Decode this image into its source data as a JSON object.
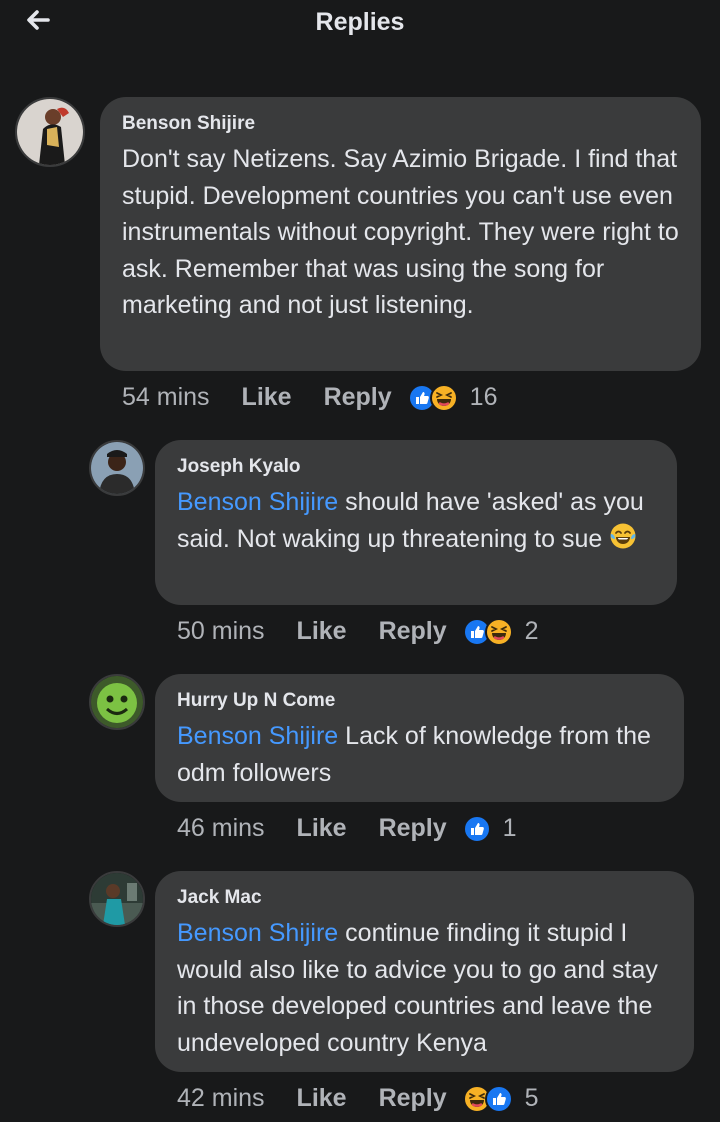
{
  "header": {
    "title": "Replies"
  },
  "comments": [
    {
      "author": "Benson Shijire",
      "text": "Don't say Netizens. Say Azimio Brigade. I find that stupid. Development countries you can't use even instrumentals without copyright. They were right to ask. Remember that was using the song for marketing and not just listening.",
      "time": "54 mins",
      "like": "Like",
      "reply": "Reply",
      "reaction_count": "16"
    },
    {
      "author": "Joseph Kyalo",
      "mention": "Benson Shijire",
      "text": " should have 'asked' as you said. Not waking up threatening to sue ",
      "time": "50 mins",
      "like": "Like",
      "reply": "Reply",
      "reaction_count": "2"
    },
    {
      "author": "Hurry Up N Come",
      "mention": "Benson Shijire",
      "text": " Lack of knowledge from the odm followers",
      "time": "46 mins",
      "like": "Like",
      "reply": "Reply",
      "reaction_count": "1"
    },
    {
      "author": "Jack Mac",
      "mention": "Benson Shijire",
      "text": " continue finding it stupid I would also like to advice you to go and stay in those developed countries and leave the undeveloped country Kenya",
      "time": "42 mins",
      "like": "Like",
      "reply": "Reply",
      "reaction_count": "5"
    }
  ]
}
